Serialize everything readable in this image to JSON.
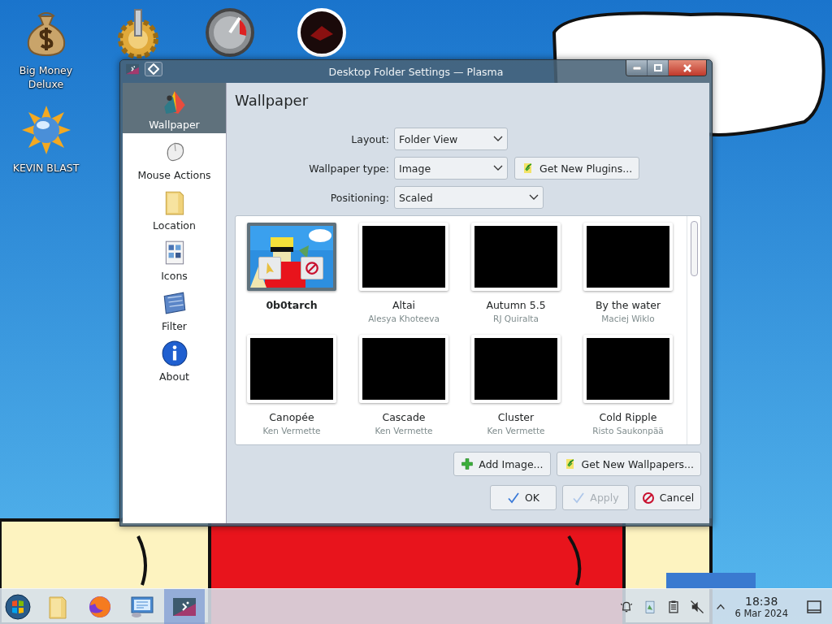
{
  "desktop_icons": [
    {
      "kind": "money",
      "label": "Big Money Deluxe"
    },
    {
      "kind": "gear"
    },
    {
      "kind": "gauge"
    },
    {
      "kind": "disc"
    },
    {
      "kind": "sun",
      "label": "KEVIN BLAST"
    }
  ],
  "window": {
    "title": "Desktop Folder Settings — Plasma",
    "sidebar": {
      "items": [
        {
          "kind": "wallpaper",
          "label": "Wallpaper",
          "selected": true
        },
        {
          "kind": "mouse",
          "label": "Mouse Actions",
          "selected": false
        },
        {
          "kind": "folder",
          "label": "Location",
          "selected": false
        },
        {
          "kind": "icons",
          "label": "Icons",
          "selected": false
        },
        {
          "kind": "filter",
          "label": "Filter",
          "selected": false
        },
        {
          "kind": "about",
          "label": "About",
          "selected": false
        }
      ]
    },
    "heading": "Wallpaper",
    "form": [
      {
        "label": "Layout:",
        "value": "Folder View"
      },
      {
        "label": "Wallpaper type:",
        "value": "Image",
        "button": "Get New Plugins..."
      },
      {
        "label": "Positioning:",
        "value": "Scaled"
      }
    ],
    "wallpapers": [
      {
        "name": "0b0tarch",
        "kind": "picture",
        "selected": true
      },
      {
        "name": "Altai",
        "author": "Alesya Khoteeva",
        "selected": false
      },
      {
        "name": "Autumn 5.5",
        "author": "RJ Quiralta",
        "selected": false
      },
      {
        "name": "By the water",
        "author": "Maciej Wiklo",
        "selected": false
      },
      {
        "name": "Canopée",
        "author": "Ken Vermette",
        "selected": false
      },
      {
        "name": "Cascade",
        "author": "Ken Vermette",
        "selected": false
      },
      {
        "name": "Cluster",
        "author": "Ken Vermette",
        "selected": false
      },
      {
        "name": "Cold Ripple",
        "author": "Risto Saukonpää",
        "selected": false
      }
    ],
    "wallpaper_buttons": [
      {
        "kind": "add",
        "label": "Add Image..."
      },
      {
        "kind": "get",
        "label": "Get New Wallpapers..."
      }
    ],
    "dialog_buttons": [
      {
        "kind": "ok",
        "label": "OK",
        "disabled": false
      },
      {
        "kind": "ok",
        "label": "Apply",
        "disabled": true
      },
      {
        "kind": "cancel",
        "label": "Cancel",
        "disabled": false
      }
    ]
  },
  "taskbar": {
    "apps": [
      {
        "kind": "folder",
        "selected": false
      },
      {
        "kind": "browser",
        "selected": false
      },
      {
        "kind": "settings",
        "selected": false
      },
      {
        "kind": "plasma",
        "selected": true
      }
    ],
    "tray": [
      {
        "kind": "bell"
      },
      {
        "kind": "clipboard"
      },
      {
        "kind": "notes"
      },
      {
        "kind": "mute"
      },
      {
        "kind": "caret"
      }
    ],
    "time": "18:38",
    "date": "6 Mar 2024"
  }
}
